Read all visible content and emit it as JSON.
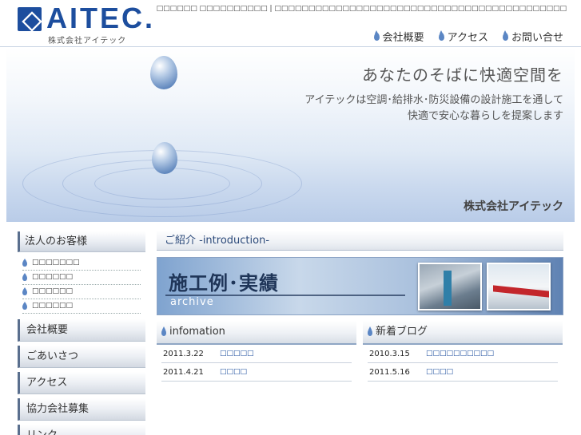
{
  "header": {
    "logo_text": "AITEC.",
    "logo_sub": "株式会社アイテック",
    "tagline": "□□□□□□ □□□□□□□□□□ | □□□□□□□□□□□□□□□□□□□□□□□□□□□□□□□□□□□□□□□□□□□",
    "nav": [
      {
        "label": "会社概要"
      },
      {
        "label": "アクセス"
      },
      {
        "label": "お問い合せ"
      }
    ]
  },
  "hero": {
    "title": "あなたのそばに快適空間を",
    "line1": "アイテックは空調･給排水･防災設備の設計施工を通して",
    "line2": "快適で安心な暮らしを提案します",
    "company": "株式会社アイテック"
  },
  "sidebar": {
    "corporate_head": "法人のお客様",
    "sub_items": [
      {
        "label": "□□□□□□□"
      },
      {
        "label": "□□□□□□"
      },
      {
        "label": "□□□□□□"
      },
      {
        "label": "□□□□□□"
      }
    ],
    "buttons": [
      {
        "label": "会社概要"
      },
      {
        "label": "ごあいさつ"
      },
      {
        "label": "アクセス"
      },
      {
        "label": "協力会社募集"
      },
      {
        "label": "リンク"
      }
    ]
  },
  "intro": {
    "title": "ご紹介 -introduction-"
  },
  "archive": {
    "title": "施工例･実績",
    "sub": "archive"
  },
  "info": {
    "title": "infomation",
    "rows": [
      {
        "date": "2011.3.22",
        "title": "□□□□□"
      },
      {
        "date": "2011.4.21",
        "title": "□□□□"
      }
    ]
  },
  "blog": {
    "title": "新着ブログ",
    "rows": [
      {
        "date": "2010.3.15",
        "title": "□□□□□□□□□□"
      },
      {
        "date": "2011.5.16",
        "title": "□□□□"
      }
    ]
  },
  "colors": {
    "brand": "#1d4e9e",
    "accent": "#5b86c4"
  }
}
